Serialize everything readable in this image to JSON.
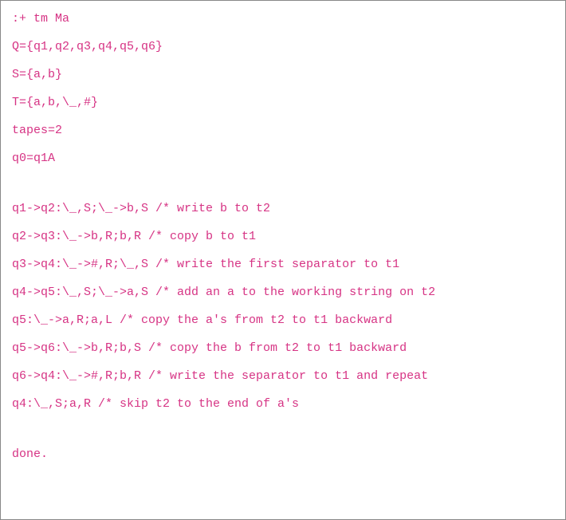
{
  "lines": [
    ":+ tm Ma",
    "Q={q1,q2,q3,q4,q5,q6}",
    "S={a,b}",
    "T={a,b,\\_,#}",
    "tapes=2",
    "q0=q1A",
    "",
    "q1->q2:\\_,S;\\_->b,S /* write b to t2",
    "q2->q3:\\_->b,R;b,R /* copy b to t1",
    "q3->q4:\\_->#,R;\\_,S /* write the first separator to t1",
    "q4->q5:\\_,S;\\_->a,S /* add an a to the working string on t2",
    "q5:\\_->a,R;a,L /* copy the a's from t2 to t1 backward",
    "q5->q6:\\_->b,R;b,S /* copy the b from t2 to t1 backward",
    "q6->q4:\\_->#,R;b,R /* write the separator to t1 and repeat",
    "q4:\\_,S;a,R /* skip t2 to the end of a's",
    "",
    "done."
  ]
}
